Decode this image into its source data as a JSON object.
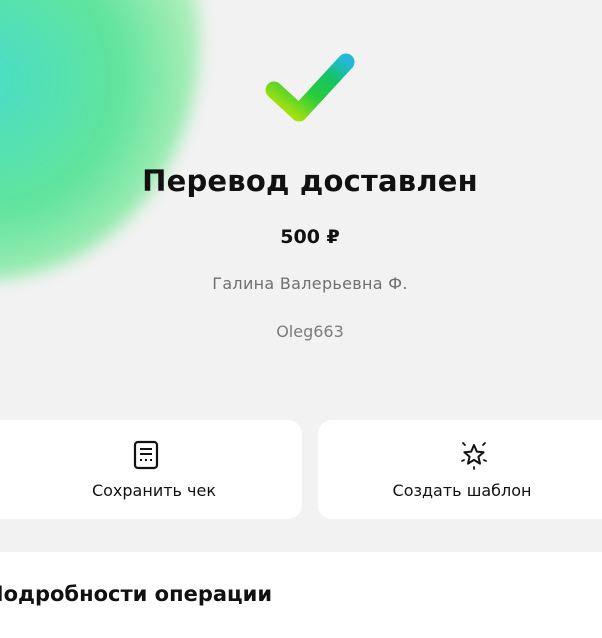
{
  "status": {
    "title": "Перевод доставлен",
    "amount": "500 ₽",
    "recipient_name": "Галина Валерьевна Ф.",
    "recipient_login": "Oleg663",
    "check_icon": "checkmark-icon"
  },
  "actions": {
    "save_receipt_label": "Сохранить чек",
    "save_receipt_icon": "receipt-icon",
    "create_template_label": "Создать шаблон",
    "create_template_icon": "sparkle-star-icon"
  },
  "details": {
    "title": "Подробности операции"
  },
  "colors": {
    "background": "#f2f2f2",
    "card": "#ffffff",
    "check_start": "#c8e600",
    "check_mid": "#1ecb4a",
    "check_end": "#20bcd6",
    "secondary_text": "#6f6f6f"
  }
}
